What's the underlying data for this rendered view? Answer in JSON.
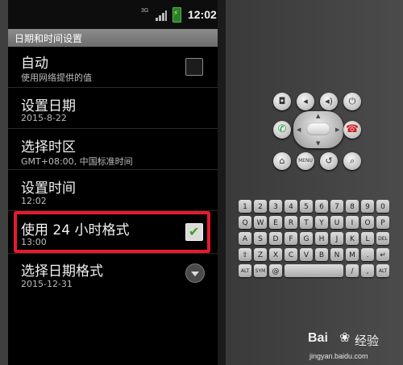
{
  "status_bar": {
    "network": "3G",
    "time": "12:02",
    "battery_icon": "battery-charging-icon",
    "signal_icon": "signal-icon"
  },
  "window_title": "日期和时间设置",
  "settings": [
    {
      "title": "自动",
      "summary": "使用网络提供的值",
      "control": "checkbox",
      "checked": false
    },
    {
      "title": "设置日期",
      "summary": "2015-8-22"
    },
    {
      "title": "选择时区",
      "summary": "GMT+08:00, 中国标准时间"
    },
    {
      "title": "设置时间",
      "summary": "12:02"
    },
    {
      "title": "使用 24 小时格式",
      "summary": "13:00",
      "control": "checkbox",
      "checked": true
    },
    {
      "title": "选择日期格式",
      "summary": "2015-12-31",
      "control": "dropdown"
    }
  ],
  "highlight_color": "#e8192d",
  "emulator": {
    "top_buttons": [
      "camera-icon",
      "volume-down-icon",
      "volume-up-icon",
      "power-icon"
    ],
    "call_button": "call-icon",
    "end_button": "end-call-icon",
    "bottom_buttons": [
      {
        "icon": "home-icon",
        "label": ""
      },
      {
        "icon": "menu-icon",
        "label": "MENU"
      },
      {
        "icon": "back-icon",
        "label": ""
      },
      {
        "icon": "search-icon",
        "label": ""
      }
    ],
    "keyboard_rows": [
      [
        "1",
        "2",
        "3",
        "4",
        "5",
        "6",
        "7",
        "8",
        "9",
        "0"
      ],
      [
        "Q",
        "W",
        "E",
        "R",
        "T",
        "Y",
        "U",
        "I",
        "O",
        "P"
      ],
      [
        "A",
        "S",
        "D",
        "F",
        "G",
        "H",
        "J",
        "K",
        "L",
        "DEL"
      ],
      [
        "⇧",
        "Z",
        "X",
        "C",
        "V",
        "B",
        "N",
        "M",
        ".",
        "↵"
      ],
      [
        "ALT",
        "SYM",
        "@",
        "",
        "",
        "",
        "/",
        ",",
        "ALT"
      ]
    ]
  },
  "watermark": {
    "logo": "Bai",
    "logo_suffix": "经验",
    "url": "jingyan.baidu.com"
  }
}
